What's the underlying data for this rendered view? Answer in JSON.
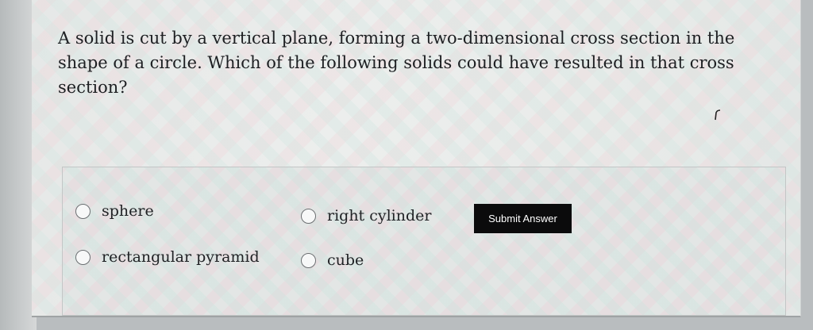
{
  "question": {
    "lines": [
      "A solid is cut by a vertical plane, forming a two-dimensional cross section in the",
      "shape of a circle. Which of the following solids could have resulted in that cross",
      "section?"
    ]
  },
  "options": [
    {
      "label": "sphere",
      "selected": false
    },
    {
      "label": "right cylinder",
      "selected": false
    },
    {
      "label": "rectangular pyramid",
      "selected": false
    },
    {
      "label": "cube",
      "selected": false
    }
  ],
  "submit": {
    "label": "Submit Answer"
  },
  "colors": {
    "button_bg": "#0b0b0c",
    "button_text": "#ffffff",
    "text": "#1d1f22"
  },
  "icons": {
    "cursor": "mouse-pointer-icon"
  }
}
